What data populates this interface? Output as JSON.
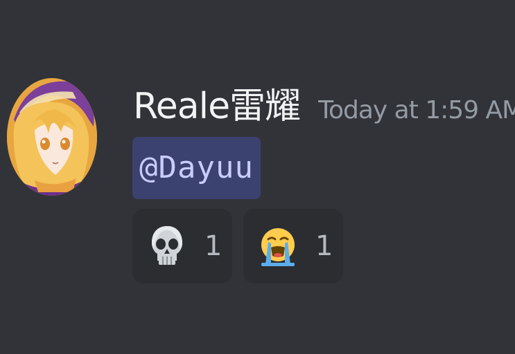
{
  "message": {
    "author": "Reale雷耀",
    "timestamp": "Today at 1:59 AM",
    "mention": "@Dayuu",
    "avatar_icon": "anime-avatar-icon",
    "reactions": [
      {
        "emoji": "skull-emoji-icon",
        "count": "1"
      },
      {
        "emoji": "loudly-crying-face-emoji-icon",
        "count": "1"
      }
    ]
  },
  "colors": {
    "background": "#313338",
    "mention_bg": "#3c4270",
    "mention_text": "#c9cdfb",
    "reaction_bg": "#2b2d31",
    "timestamp": "#949ba4"
  }
}
